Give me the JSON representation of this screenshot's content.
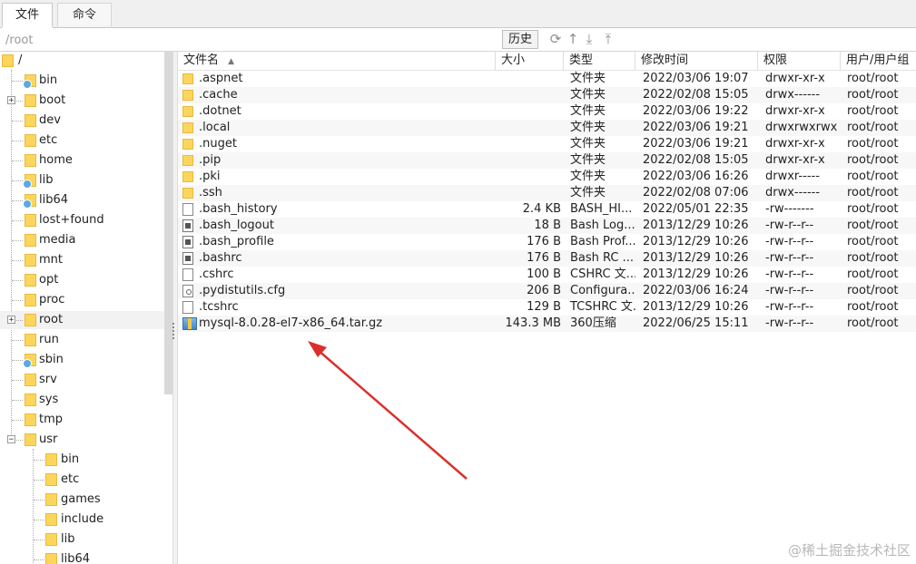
{
  "tabs": [
    "文件",
    "命令"
  ],
  "path": {
    "value": "/root"
  },
  "history_button": "历史",
  "toolbar_icons": [
    "refresh-icon",
    "go-up-icon",
    "download-icon",
    "upload-icon"
  ],
  "tree": {
    "root_label": "/",
    "items": [
      "bin",
      "boot",
      "dev",
      "etc",
      "home",
      "lib",
      "lib64",
      "lost+found",
      "media",
      "mnt",
      "opt",
      "proc",
      "root",
      "run",
      "sbin",
      "srv",
      "sys",
      "tmp",
      "usr"
    ],
    "usr_children": [
      "bin",
      "etc",
      "games",
      "include",
      "lib",
      "lib64"
    ]
  },
  "columns": [
    "文件名",
    "大小",
    "类型",
    "修改时间",
    "权限",
    "用户/用户组"
  ],
  "files": [
    {
      "name": ".aspnet",
      "size": "",
      "type": "文件夹",
      "mtime": "2022/03/06 19:07",
      "perm": "drwxr-xr-x",
      "owner": "root/root",
      "icon": "folder"
    },
    {
      "name": ".cache",
      "size": "",
      "type": "文件夹",
      "mtime": "2022/02/08 15:05",
      "perm": "drwx------",
      "owner": "root/root",
      "icon": "folder"
    },
    {
      "name": ".dotnet",
      "size": "",
      "type": "文件夹",
      "mtime": "2022/03/06 19:22",
      "perm": "drwxr-xr-x",
      "owner": "root/root",
      "icon": "folder"
    },
    {
      "name": ".local",
      "size": "",
      "type": "文件夹",
      "mtime": "2022/03/06 19:21",
      "perm": "drwxrwxrwx",
      "owner": "root/root",
      "icon": "folder"
    },
    {
      "name": ".nuget",
      "size": "",
      "type": "文件夹",
      "mtime": "2022/03/06 19:21",
      "perm": "drwxr-xr-x",
      "owner": "root/root",
      "icon": "folder"
    },
    {
      "name": ".pip",
      "size": "",
      "type": "文件夹",
      "mtime": "2022/02/08 15:05",
      "perm": "drwxr-xr-x",
      "owner": "root/root",
      "icon": "folder"
    },
    {
      "name": ".pki",
      "size": "",
      "type": "文件夹",
      "mtime": "2022/03/06 16:26",
      "perm": "drwxr-----",
      "owner": "root/root",
      "icon": "folder"
    },
    {
      "name": ".ssh",
      "size": "",
      "type": "文件夹",
      "mtime": "2022/02/08 07:06",
      "perm": "drwx------",
      "owner": "root/root",
      "icon": "folder"
    },
    {
      "name": ".bash_history",
      "size": "2.4 KB",
      "type": "BASH_HI...",
      "mtime": "2022/05/01 22:35",
      "perm": "-rw-------",
      "owner": "root/root",
      "icon": "file"
    },
    {
      "name": ".bash_logout",
      "size": "18 B",
      "type": "Bash Log...",
      "mtime": "2013/12/29 10:26",
      "perm": "-rw-r--r--",
      "owner": "root/root",
      "icon": "app"
    },
    {
      "name": ".bash_profile",
      "size": "176 B",
      "type": "Bash Prof...",
      "mtime": "2013/12/29 10:26",
      "perm": "-rw-r--r--",
      "owner": "root/root",
      "icon": "app"
    },
    {
      "name": ".bashrc",
      "size": "176 B",
      "type": "Bash RC ...",
      "mtime": "2013/12/29 10:26",
      "perm": "-rw-r--r--",
      "owner": "root/root",
      "icon": "app"
    },
    {
      "name": ".cshrc",
      "size": "100 B",
      "type": "CSHRC 文...",
      "mtime": "2013/12/29 10:26",
      "perm": "-rw-r--r--",
      "owner": "root/root",
      "icon": "file"
    },
    {
      "name": ".pydistutils.cfg",
      "size": "206 B",
      "type": "Configura...",
      "mtime": "2022/03/06 16:24",
      "perm": "-rw-r--r--",
      "owner": "root/root",
      "icon": "cfg"
    },
    {
      "name": ".tcshrc",
      "size": "129 B",
      "type": "TCSHRC 文...",
      "mtime": "2013/12/29 10:26",
      "perm": "-rw-r--r--",
      "owner": "root/root",
      "icon": "file"
    },
    {
      "name": "mysql-8.0.28-el7-x86_64.tar.gz",
      "size": "143.3 MB",
      "type": "360压缩",
      "mtime": "2022/06/25 15:11",
      "perm": "-rw-r--r--",
      "owner": "root/root",
      "icon": "archive"
    }
  ],
  "watermark": "@稀土掘金技术社区",
  "colors": {
    "folder": "#fcd65c",
    "arrow": "#d9302c",
    "selected_row": "#f2f2f2"
  }
}
